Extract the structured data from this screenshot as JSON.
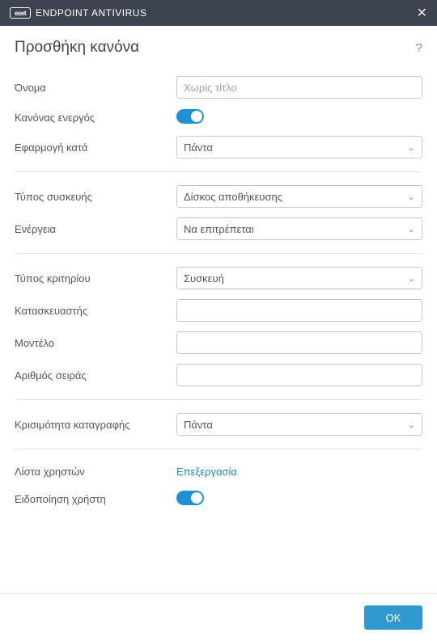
{
  "titlebar": {
    "logo_text": "eset",
    "product": "ENDPOINT ANTIVIRUS"
  },
  "header": {
    "title": "Προσθήκη κανόνα",
    "help": "?"
  },
  "fields": {
    "name": {
      "label": "Όνομα",
      "placeholder": "Χωρίς τίτλο",
      "value": ""
    },
    "rule_enabled": {
      "label": "Κανόνας ενεργός",
      "on": true
    },
    "apply_during": {
      "label": "Εφαρμογή κατά",
      "value": "Πάντα"
    },
    "device_type": {
      "label": "Τύπος συσκευής",
      "value": "Δίσκος αποθήκευσης"
    },
    "action": {
      "label": "Ενέργεια",
      "value": "Να επιτρέπεται"
    },
    "criteria_type": {
      "label": "Τύπος κριτηρίου",
      "value": "Συσκευή"
    },
    "vendor": {
      "label": "Κατασκευαστής",
      "value": ""
    },
    "model": {
      "label": "Μοντέλο",
      "value": ""
    },
    "serial": {
      "label": "Αριθμός σειράς",
      "value": ""
    },
    "severity": {
      "label": "Κρισιμότητα καταγραφής",
      "value": "Πάντα"
    },
    "user_list": {
      "label": "Λίστα χρηστών",
      "link": "Επεξεργασία"
    },
    "notify_user": {
      "label": "Ειδοποίηση χρήστη",
      "on": true
    }
  },
  "footer": {
    "ok": "OK"
  }
}
